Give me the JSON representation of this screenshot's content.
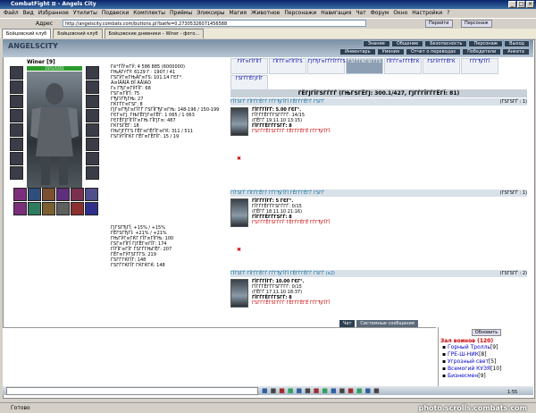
{
  "window": {
    "title": "CombatFight ⊞ - Angels City"
  },
  "menu": {
    "items": [
      "Файл",
      "Вид",
      "Избранное",
      "Утилиты",
      "Подвески",
      "Комплекты",
      "Приёмы",
      "Эликсиры",
      "Магия",
      "Животное",
      "Персонажи",
      "Навигация",
      "Чат",
      "Форум",
      "Окно",
      "Настройки",
      "?"
    ]
  },
  "address": {
    "label": "Адрес",
    "value": "http://angelscity.combats.com/buttons.pl?batfe=0.27305326071456588",
    "go": "Перейти",
    "side": "Персонаж"
  },
  "tabs": [
    {
      "label": "Бойцовский клуб"
    },
    {
      "label": "Бойцовский клуб"
    },
    {
      "label": "Бойцовские дневники – Winer - фото..."
    }
  ],
  "top_nav": {
    "row1": [
      "Знание",
      "Общение",
      "Безопасность",
      "Персонаж",
      "Выход"
    ],
    "row2": [
      "Инвентарь",
      "Умения",
      "Отчет о переводах",
      "Победители",
      "Анкета"
    ]
  },
  "character": {
    "name": "Winer",
    "level": "[9]",
    "hp": "1551/1551"
  },
  "stats": [
    "Гё°ГЇÝ≡ГЎ: 4 586 885 (6000000)",
    "ГЊÁГѓЃÝ: 6129 Г · 1907 / 41",
    "ГЅГЎГ≡ГЊÁГ≡ГЅ:   101.14 ГЄГ°.",
    "Ã≡ÎÄÅÍÅ ÐÏ ÃÅÌÀÒ",
    "Гѕ ГЂГ≡ГЎГЇГ: 68",
    "ГЅГ≡ГЇГЇ: 75",
    "ГЂГІГЂГЊ: 27",
    "ГЌГЃГ≡ГЅГ: 8",
    "ГЈГ≡ГЂГ≡ГЇГЃ ГЅГЇГЂГ≡ГЊ: 148-196 / 150-199",
    "ГЄГ≡ГЈ. ГЊГЁГЈГ≡ГЁГ: 1 065 / 1 063",
    "ГЄГЁГЈГЇГЇГ≡ГЊ ГЇГЈГ≡: 487",
    "ГЌГЅГЁГ: 18",
    "ГЊГЈГЃГЅ ГЁГ≡ГЁГЇГ≡ГЌ: 311 / 511",
    "ГЅГЎГЇГЌГ ГЁГ≡ГЁГЇГ: 15 / 19"
  ],
  "mods": [
    "ГЈГЅГЂГЇ: +15% / +15%",
    "ГЁГЅГЂГЇ: +21% / +21%",
    "ГЊГЎГ≡ГЌГ ГЇГ≡ГЇГЊ: 100",
    "ГЅГ≡ГЇГЇ ГЈГЁГ≡ГЇГ: 174",
    "ГЇГЇГ≡ГЇГ ГЅГЃГЊГЁГ: 207",
    "ГЁГ≡ГЎГЅГЃГЅ: 219",
    "ГЅГЃГЌГЇГ: 148",
    "ГЅГЃГЌГЇГ ГЌГЌГЌ: 148"
  ],
  "center_tabs": [
    "ГЎГ≡ГЇГЇГЇ",
    "ГЇГЃГ≡ГЇГЇГЅ",
    "ГЈГЂГ≡ГЃГЇГЃГЅ",
    "ГЅГЃГЌГЅГЃГЅ",
    "ГЇГЃГ≡ГЃГЁГЌ",
    "ГЅГЎГЃГЁГЌ",
    "ГЃГЂГЇГЇ",
    "ГЅГЃГЁГЈГЇГ"
  ],
  "section_title": "ГЁГЈГЇГЅГЃГЃ (ГЊГЅГЁГЈ: 300.1/427, ГЈГЃГЇГЃГЁГЇ: 81)",
  "entries": [
    {
      "title": "ГЇГЅГЃ ГЇГЃГЁГЃ ГЃГЂГЇГЇ ГЁГЃГЁГЃ ГЅГЃ",
      "count": "(ГЅГЅГЃ : 1)",
      "price": "ГЇГЃГЇГЃ: 5.00 ГЄГ°.",
      "dur": "ГЇГЃГЁГЃГЅГЃГЃ: 14/15",
      "time": "(ГЁГЃ 19.11.10 13:15)",
      "req": "ГЇГЃГЁГЃГЅГЃ: 8",
      "warn": "ГЅГЃГЁГЅГЃГЃ ГЁГЃГЁГЁ ГЃГЂГЇГЇ"
    },
    {
      "title": "ГЇГЅГЃ ГЇГЃГЁГЃ ГЃГЂГЇГЇ ГЁГЃГЁГЃ ГЅГЃ",
      "count": "(ГЅГЅГЃ : 1)",
      "price": "ГЇГЃГЇГЃ: 5 ГЄГ°.",
      "dur": "ГЇГЃГЁГЃГЅГЃГЃ: 0/15",
      "time": "(ГЁГЃ 18.11.10 21:16)",
      "req": "ГЇГЃГЁГЃГЅГЃ: 8",
      "warn": "ГЅГЃГЁГЅГЃГЃ ГЁГЃГЁГЁ ГЃГЂГЇГЇ"
    },
    {
      "title": "ГЇГЅГЃ ГЇГЃГЁГЃ ГЃГЂГЇГЇ ГЁГЃГЁГЃ ГЅГЃ (x2)",
      "count": "(ГЅГЅГЃ : 2)",
      "price": "ГЇГЃГЇГЃ: 10.00 ГЄГ°.",
      "dur": "ГЇГЃГЁГЃГЅГЃГЃ: 0/15",
      "time": "(ГЁГЃ 17.11.10 18:37)",
      "req": "ГЇГЃГЁГЃГЅГЃ: 8",
      "warn": "ГЅГЃГЁГЅГЃГЃ ГЁГЃГЁГЁ ГЃГЂГЇГЇ"
    }
  ],
  "chat": {
    "tabs": [
      "Чат",
      "Системные сообщения"
    ]
  },
  "userlist": {
    "refresh": "Обновить",
    "room": "Зал воинов (120)",
    "users": [
      {
        "name": "Горный Тролль",
        "lvl": "[9]"
      },
      {
        "name": "ГРЕ-Ш-НИК",
        "lvl": "[8]"
      },
      {
        "name": "Угрозный свет",
        "lvl": "[5]"
      },
      {
        "name": "Всемогий КУЗЯ",
        "lvl": "[10]"
      },
      {
        "name": "Бизнесмен",
        "lvl": "[9]"
      }
    ]
  },
  "status": {
    "text": "Готово",
    "watermark": "photo.scrolls.combats.com",
    "clock": "1:55"
  }
}
